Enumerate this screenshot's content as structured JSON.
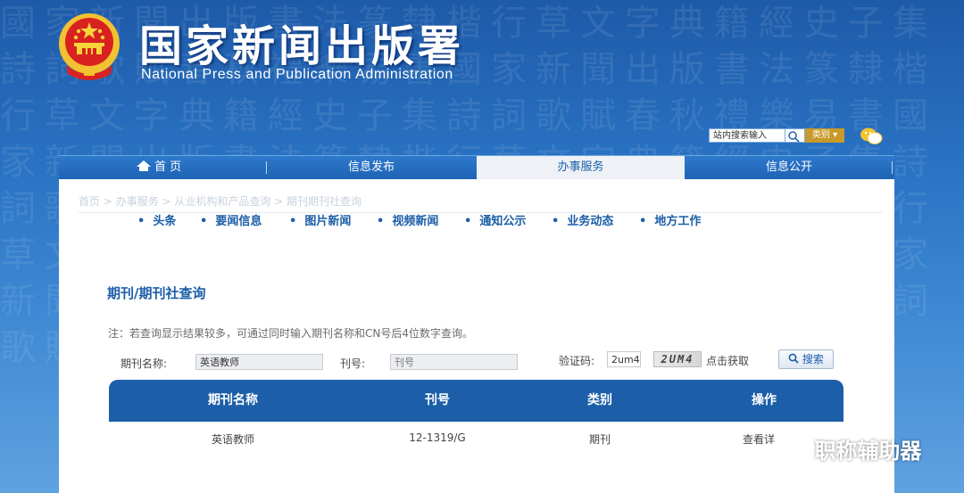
{
  "header": {
    "title_cn": "国家新闻出版署",
    "title_en": "National Press and Publication Administration"
  },
  "top_search": {
    "placeholder": "站内搜索输入",
    "category_label": "类别 ▾"
  },
  "nav": {
    "items": [
      {
        "label": "首 页"
      },
      {
        "label": "信息发布"
      },
      {
        "label": "办事服务",
        "active": true
      },
      {
        "label": "信息公开"
      }
    ]
  },
  "breadcrumb": "首页 > 办事服务 > 从业机构和产品查询 > 期刊期刊社查询",
  "subnav": [
    "头条",
    "要闻信息",
    "图片新闻",
    "视频新闻",
    "通知公示",
    "业务动态",
    "地方工作"
  ],
  "query": {
    "heading": "期刊/期刊社查询",
    "note": "注：若查询显示结果较多，可通过同时输入期刊名称和CN号后4位数字查询。",
    "name_label": "期刊名称:",
    "name_value": "英语教师",
    "cn_label": "刊号:",
    "cn_placeholder": "刊号",
    "captcha_label": "验证码:",
    "captcha_value": "2um4",
    "captcha_image_text": "2UM4",
    "refresh_label": "点击获取",
    "search_label": "搜索"
  },
  "table": {
    "headers": [
      "期刊名称",
      "刊号",
      "类别",
      "操作"
    ],
    "rows": [
      [
        "英语教师",
        "12-1319/G",
        "期刊",
        "查看详"
      ]
    ]
  },
  "watermark": "职称辅助器",
  "colors": {
    "brand_blue": "#1c5ea8",
    "accent_gold": "#c79a2b"
  }
}
